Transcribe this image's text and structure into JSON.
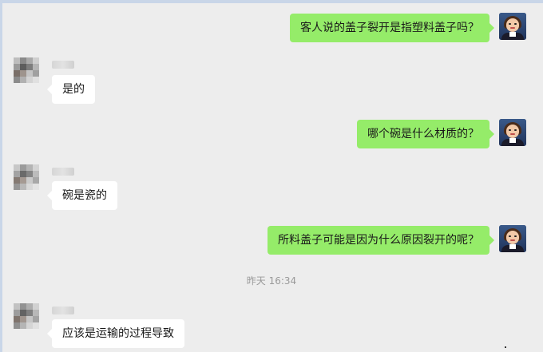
{
  "chat": {
    "messages": [
      {
        "side": "out",
        "text": "客人说的盖子裂开是指塑料盖子吗？"
      },
      {
        "side": "in",
        "text": "是的"
      },
      {
        "side": "out",
        "text": "哪个碗是什么材质的？"
      },
      {
        "side": "in",
        "text": "碗是瓷的"
      },
      {
        "side": "out",
        "text": "所料盖子可能是因为什么原因裂开的呢？"
      },
      {
        "side": "in",
        "text": "应该是运输的过程导致"
      }
    ],
    "timestamp": "昨天 16:34"
  },
  "colors": {
    "outgoing_bubble": "#95ec69",
    "incoming_bubble": "#ffffff",
    "background": "#ededed",
    "timestamp_text": "#999999"
  },
  "icons": {
    "self_avatar": "user-avatar-icon",
    "contact_avatar": "blurred-contact-avatar-icon"
  }
}
